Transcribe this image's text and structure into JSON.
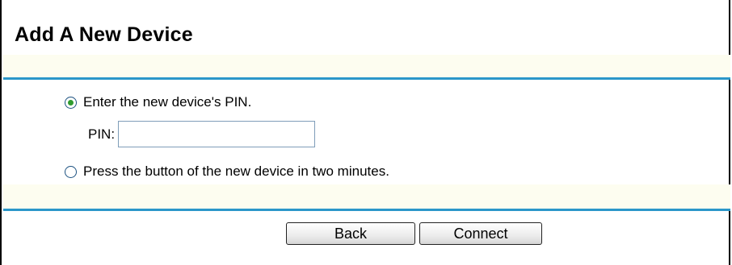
{
  "page": {
    "title": "Add A New Device"
  },
  "options": {
    "pin": {
      "label": "Enter the new device's PIN.",
      "selected": true
    },
    "pin_field": {
      "label": "PIN:",
      "value": ""
    },
    "push_button": {
      "label": "Press the button of the new device in two minutes.",
      "selected": false
    }
  },
  "buttons": {
    "back_label": "Back",
    "connect_label": "Connect"
  },
  "colors": {
    "rule": "#2b97c9",
    "band": "#fdfdf0",
    "radio_dot": "#2f9b2f"
  }
}
